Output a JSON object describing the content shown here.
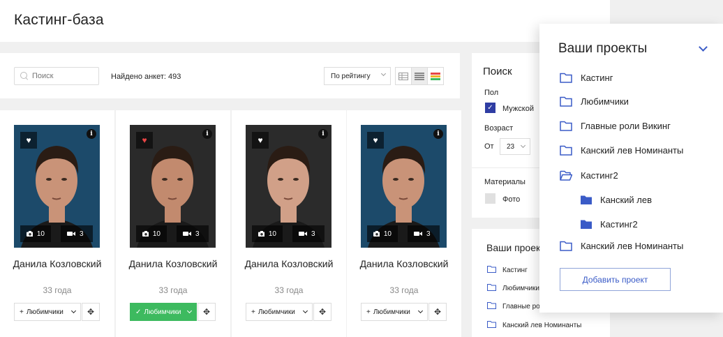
{
  "header": {
    "title": "Кастинг-база"
  },
  "toolbar": {
    "search_placeholder": "Поиск",
    "found_text": "Найдено анкет: 493",
    "sort_value": "По рейтингу",
    "view_icons": [
      "table-view-icon",
      "list-view-icon",
      "color-grid-icon"
    ]
  },
  "cards": [
    {
      "name": "Данила Козловский",
      "age": "33 года",
      "photos": "10",
      "videos": "3",
      "favorited": false,
      "fav_label": "Любимчики",
      "fav_icon": "+"
    },
    {
      "name": "Данила Козловский",
      "age": "33 года",
      "photos": "10",
      "videos": "3",
      "favorited": true,
      "fav_label": "Любимчики",
      "fav_icon": "✓"
    },
    {
      "name": "Данила Козловский",
      "age": "33 года",
      "photos": "10",
      "videos": "3",
      "favorited": false,
      "fav_label": "Любимчики",
      "fav_icon": "+"
    },
    {
      "name": "Данила Козловский",
      "age": "33 года",
      "photos": "10",
      "videos": "3",
      "favorited": false,
      "fav_label": "Любимчики",
      "fav_icon": "+"
    }
  ],
  "filter": {
    "title": "Поиск",
    "gender_label": "Пол",
    "gender_option": "Мужской",
    "age_label": "Возраст",
    "age_from_label": "От",
    "age_from_value": "23",
    "materials_label": "Материалы",
    "materials_option": "Фото"
  },
  "projects_small": {
    "title": "Ваши проекты",
    "items": [
      "Кастинг",
      "Любимчики",
      "Главные роли Викинг",
      "Канский лев Номинанты"
    ]
  },
  "projects_dropdown": {
    "title": "Ваши проекты",
    "items": [
      {
        "label": "Кастинг",
        "level": 0,
        "icon": "folder-outline-icon"
      },
      {
        "label": "Любимчики",
        "level": 0,
        "icon": "folder-outline-icon"
      },
      {
        "label": "Главные роли Викинг",
        "level": 0,
        "icon": "folder-outline-icon"
      },
      {
        "label": "Канский лев Номинанты",
        "level": 0,
        "icon": "folder-outline-icon"
      },
      {
        "label": "Кастинг2",
        "level": 0,
        "icon": "folder-open-icon"
      },
      {
        "label": "Канский лев",
        "level": 1,
        "icon": "folder-filled-icon"
      },
      {
        "label": "Кастинг2",
        "level": 1,
        "icon": "folder-filled-icon"
      },
      {
        "label": "Канский лев Номинанты",
        "level": 0,
        "icon": "folder-outline-icon"
      }
    ],
    "add_button": "Добавить проект"
  },
  "colors": {
    "accent": "#3a5bc7",
    "green": "#3dba5f",
    "checkbox": "#2f3da3",
    "heart_active": "#e84545"
  }
}
